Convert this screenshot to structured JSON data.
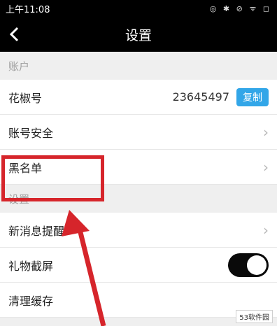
{
  "status_bar": {
    "time": "上午11:08",
    "icons": "◎ ✱ ⊘ ᯤ ◻"
  },
  "header": {
    "title": "设置"
  },
  "sections": {
    "account": "账户",
    "settings": "设置"
  },
  "rows": {
    "huajiao_id": {
      "label": "花椒号",
      "value": "23645497",
      "button": "复制"
    },
    "account_security": {
      "label": "账号安全"
    },
    "blacklist": {
      "label": "黑名单"
    },
    "new_message": {
      "label": "新消息提醒"
    },
    "gift_screenshot": {
      "label": "礼物截屏",
      "toggle_on": true
    },
    "clear_cache": {
      "label": "清理缓存"
    }
  },
  "watermark": "53软件园",
  "colors": {
    "accent": "#32a6e8",
    "highlight": "#d6252b"
  }
}
